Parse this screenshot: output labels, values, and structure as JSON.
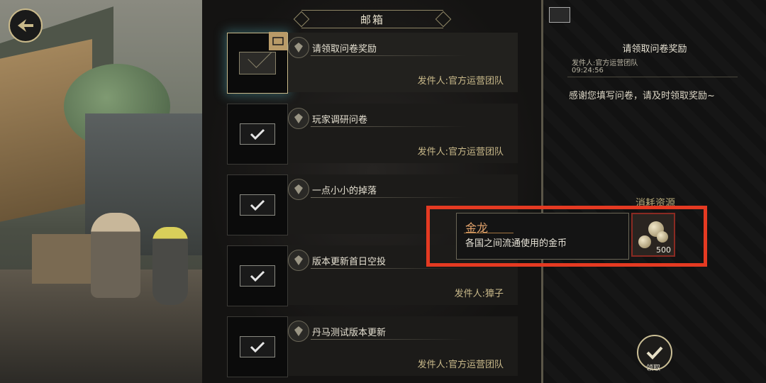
{
  "mailbox": {
    "title": "邮箱",
    "items": [
      {
        "title": "请领取问卷奖励",
        "sender": "发件人:官方运营团队",
        "state": "unread"
      },
      {
        "title": "玩家调研问卷",
        "sender": "发件人:官方运营团队",
        "state": "claimed"
      },
      {
        "title": "一点小小的掉落",
        "sender": "",
        "state": "claimed"
      },
      {
        "title": "版本更新首日空投",
        "sender": "发件人:獐子",
        "state": "claimed"
      },
      {
        "title": "丹马测试版本更新",
        "sender": "发件人:官方运营团队",
        "state": "claimed"
      }
    ]
  },
  "detail": {
    "title": "请领取问卷奖励",
    "sender": "发件人:官方运营团队",
    "time": "09:24:56",
    "body": "感谢您填写问卷，请及时领取奖励~",
    "resources_label": "消耗资源",
    "claim_label": "领取"
  },
  "tooltip": {
    "item_name": "金龙",
    "item_desc": "各国之间流通使用的金币",
    "quantity": "500"
  },
  "colors": {
    "highlight": "#e53a22",
    "gold_text": "#c9b98a",
    "item_name": "#e2a36c",
    "selected_glow": "#50a0aa"
  },
  "icons": [
    "back-arrow-icon",
    "envelope-icon",
    "checkmark-icon",
    "badge-icon",
    "gold-coins-icon"
  ]
}
